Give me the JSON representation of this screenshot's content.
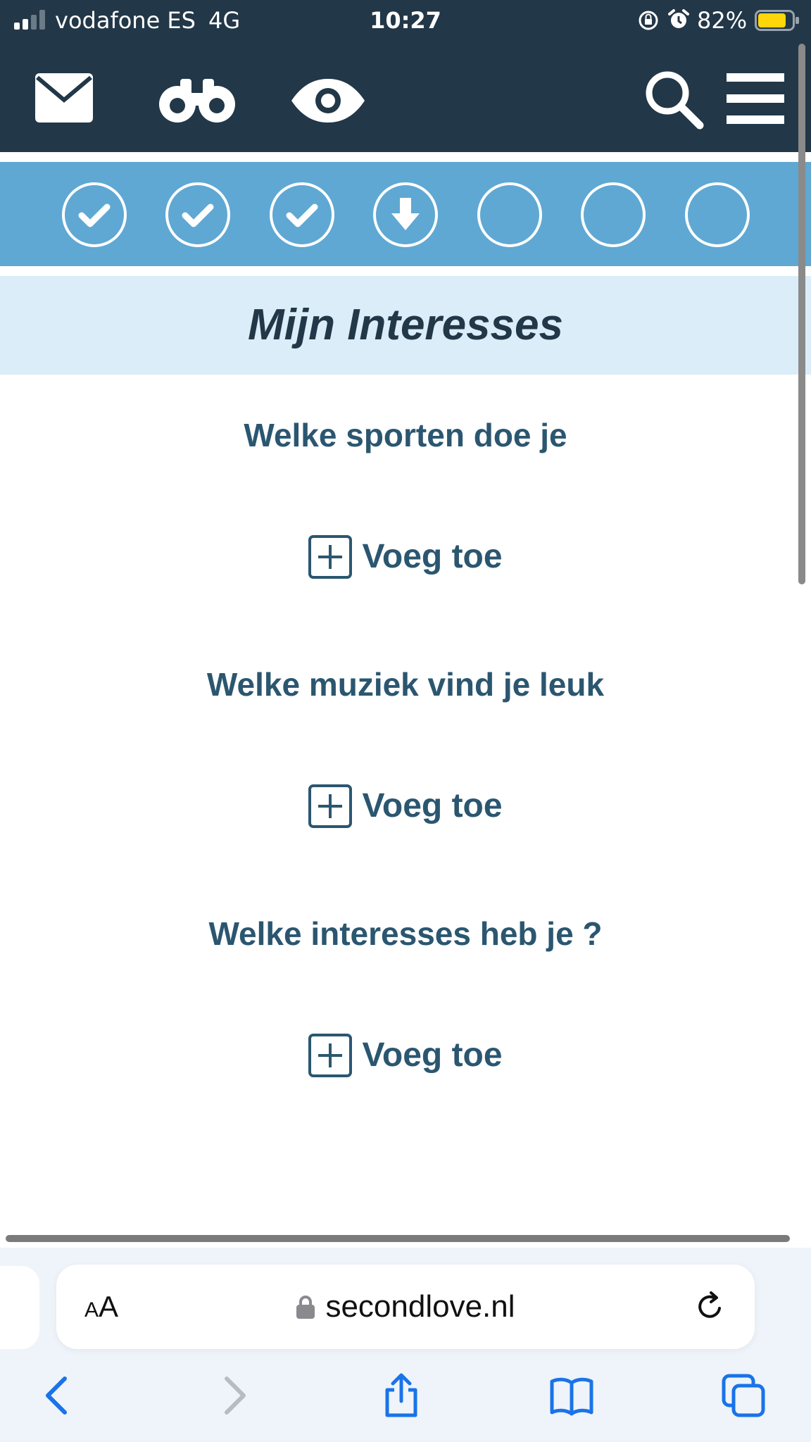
{
  "status_bar": {
    "carrier": "vodafone ES",
    "network": "4G",
    "time": "10:27",
    "battery_percent": "82%",
    "battery_level": 0.82,
    "signal_bars_filled": 2,
    "signal_bars_total": 4
  },
  "top_nav": {
    "icons": [
      "mail-icon",
      "binoculars-icon",
      "eye-icon",
      "search-icon",
      "menu-icon"
    ]
  },
  "steps": {
    "total": 7,
    "states": [
      "done",
      "done",
      "done",
      "current",
      "todo",
      "todo",
      "todo"
    ]
  },
  "section": {
    "title": "Mijn Interesses"
  },
  "questions": [
    {
      "label": "Welke sporten doe je",
      "add_label": "Voeg toe"
    },
    {
      "label": "Welke muziek vind je leuk",
      "add_label": "Voeg toe"
    },
    {
      "label": "Welke interesses heb je ?",
      "add_label": "Voeg toe"
    }
  ],
  "browser": {
    "aa_small": "A",
    "aa_big": "A",
    "url": "secondlove.nl",
    "toolbar_icons": [
      "back-icon",
      "forward-icon",
      "share-icon",
      "bookmarks-icon",
      "tabs-icon"
    ]
  },
  "colors": {
    "nav_bg": "#223748",
    "steps_bg": "#5fa8d3",
    "heading_bg": "#daedf8",
    "text_primary": "#2b5670",
    "browser_accent": "#1a73e8",
    "battery": "#ffd60a"
  }
}
